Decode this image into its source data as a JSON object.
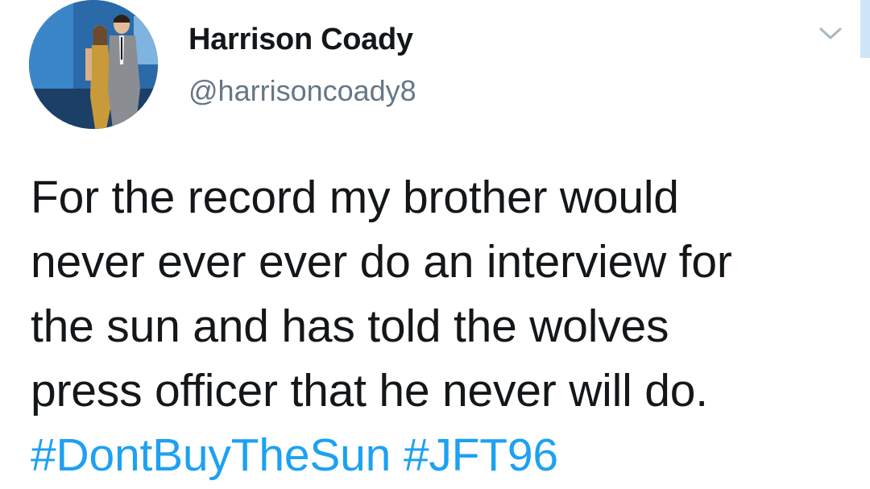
{
  "colors": {
    "text": "#14171a",
    "secondary": "#657786",
    "link": "#1da1f2",
    "background": "#ffffff"
  },
  "author": {
    "display_name": "Harrison Coady",
    "handle": "@harrisoncoady8",
    "avatar_icon": "profile-photo"
  },
  "header": {
    "menu_icon": "chevron-down-icon"
  },
  "tweet": {
    "lines": [
      "For the record my brother would",
      "never ever ever do an interview for",
      "the sun and has told the wolves",
      "press officer that he never will do."
    ],
    "hashtags": [
      "#DontBuyTheSun",
      "#JFT96"
    ]
  }
}
